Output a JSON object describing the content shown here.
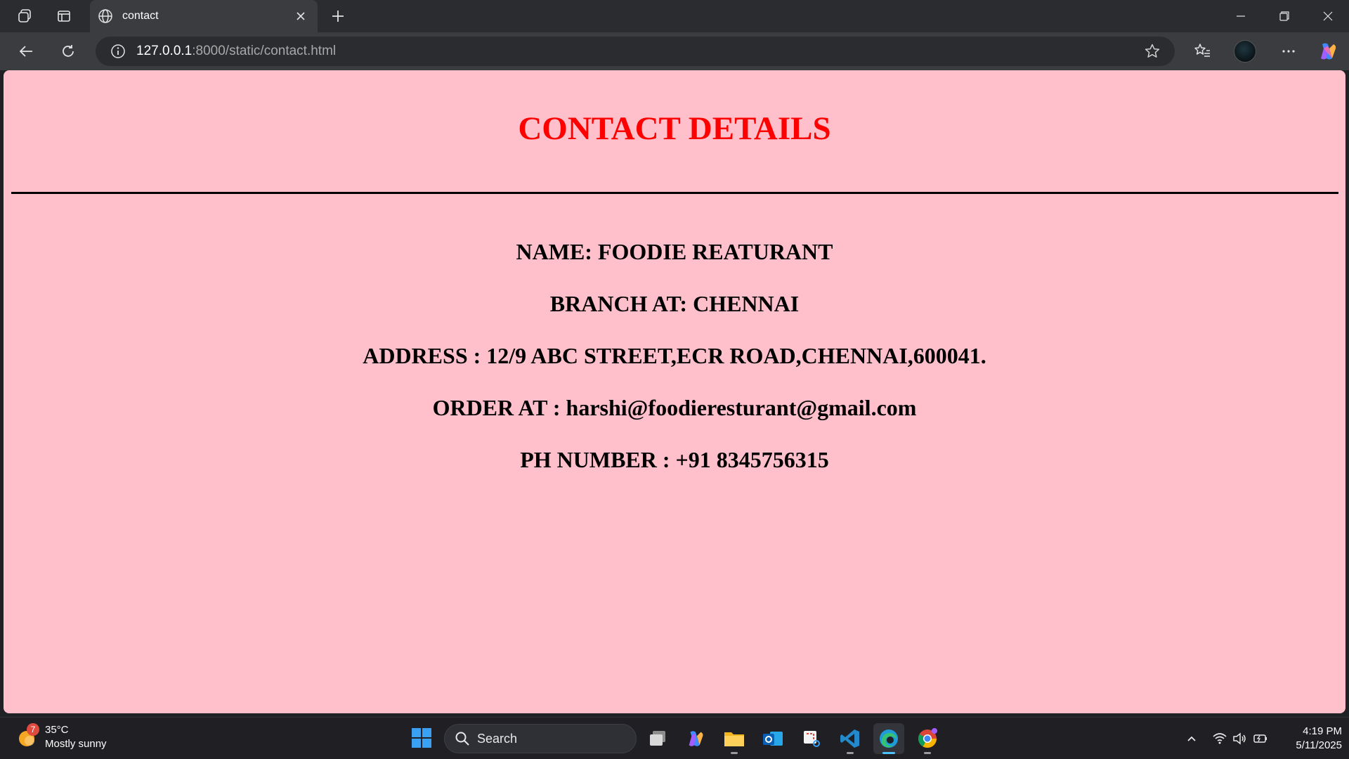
{
  "browser": {
    "tab_title": "contact",
    "url_host": "127.0.0.1",
    "url_rest": ":8000/static/contact.html"
  },
  "page": {
    "title": "CONTACT DETAILS",
    "details": [
      "NAME: FOODIE REATURANT",
      "BRANCH AT: CHENNAI",
      "ADDRESS : 12/9 ABC STREET,ECR ROAD,CHENNAI,600041.",
      "ORDER AT : harshi@foodieresturant@gmail.com",
      "PH NUMBER : +91 8345756315"
    ],
    "title_color": "#ff0000",
    "background_color": "#ffc0cb"
  },
  "taskbar": {
    "weather_temp": "35°C",
    "weather_desc": "Mostly sunny",
    "weather_badge": "7",
    "search_label": "Search",
    "time": "4:19 PM",
    "date": "5/11/2025"
  }
}
